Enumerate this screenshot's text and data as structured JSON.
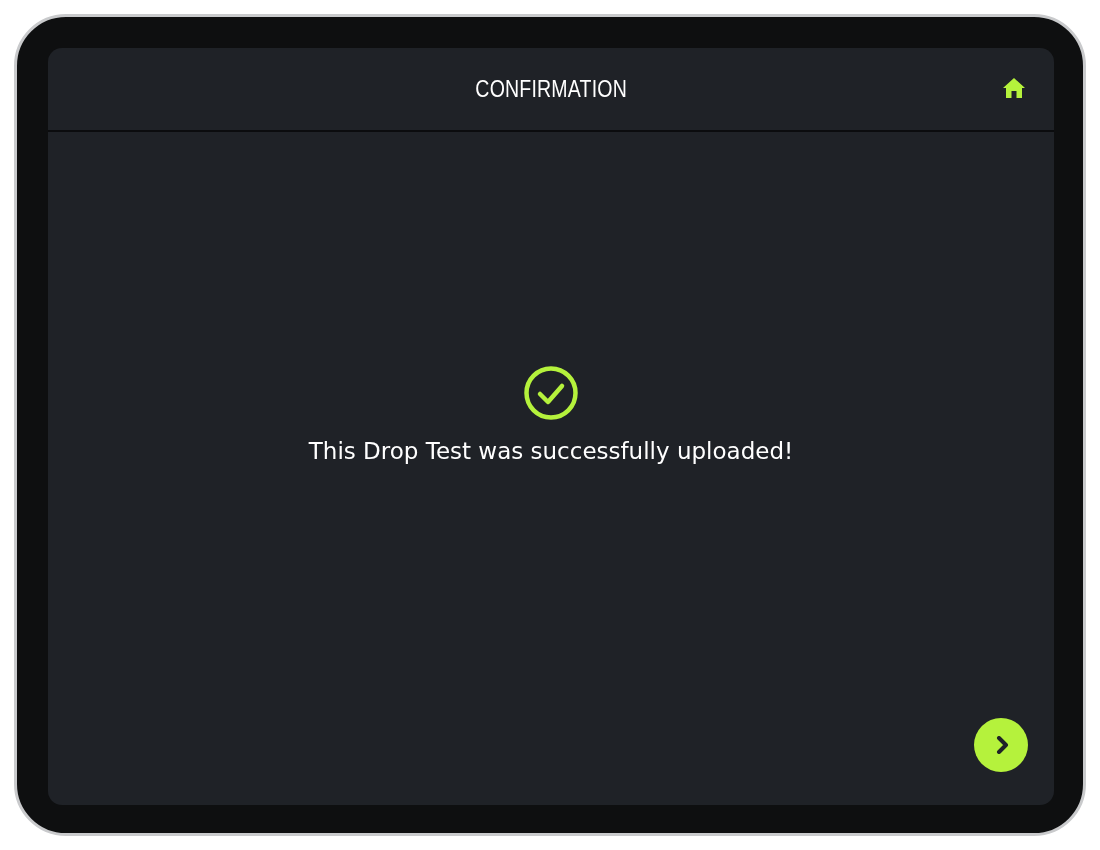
{
  "header": {
    "title": "CONFIRMATION"
  },
  "message": "This Drop Test was successfully uploaded!"
}
